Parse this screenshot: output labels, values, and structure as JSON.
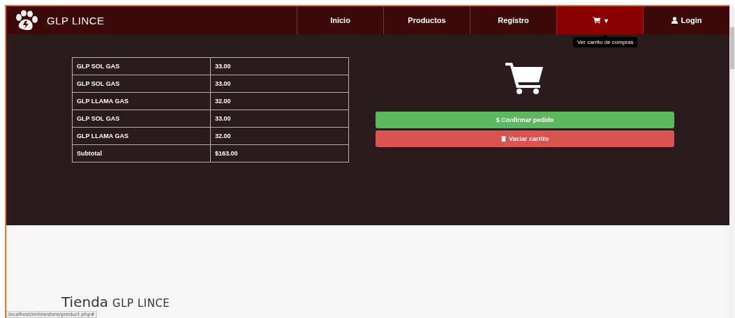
{
  "navbar": {
    "brand": "GLP LINCE",
    "items": [
      {
        "label": "Inicio",
        "kind": "text",
        "selected": false
      },
      {
        "label": "Productos",
        "kind": "text",
        "selected": false
      },
      {
        "label": "Registro",
        "kind": "text",
        "selected": false
      },
      {
        "label": "▾",
        "kind": "cart",
        "selected": true
      },
      {
        "label": "Login",
        "kind": "user",
        "selected": false
      }
    ],
    "tooltip": "Ver carrito de compras"
  },
  "cart_table": {
    "rows": [
      {
        "product": "GLP SOL GAS",
        "price": "33.00"
      },
      {
        "product": "GLP SOL GAS",
        "price": "33.00"
      },
      {
        "product": "GLP LLAMA GAS",
        "price": "32.00"
      },
      {
        "product": "GLP SOL GAS",
        "price": "33.00"
      },
      {
        "product": "GLP LLAMA GAS",
        "price": "32.00"
      },
      {
        "product": "Subtotal",
        "price": "$163.00"
      }
    ]
  },
  "buttons": [
    {
      "label": "$ Confirmar pedido",
      "kind": "confirm"
    },
    {
      "label": "Vaciar carrito",
      "kind": "empty"
    }
  ],
  "store_title": {
    "main": "Tienda",
    "brand": "GLP LINCE"
  },
  "status_url": "localhost/onlinestore/product.php#"
}
